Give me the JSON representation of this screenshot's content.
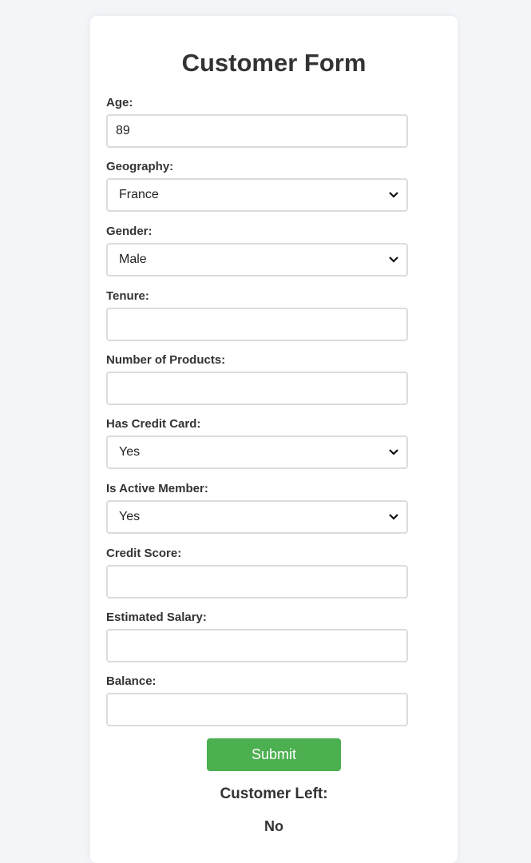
{
  "form": {
    "title": "Customer Form",
    "age": {
      "label": "Age:",
      "value": "89"
    },
    "geography": {
      "label": "Geography:",
      "value": "France"
    },
    "gender": {
      "label": "Gender:",
      "value": "Male"
    },
    "tenure": {
      "label": "Tenure:",
      "value": ""
    },
    "num_products": {
      "label": "Number of Products:",
      "value": ""
    },
    "has_credit_card": {
      "label": "Has Credit Card:",
      "value": "Yes"
    },
    "is_active_member": {
      "label": "Is Active Member:",
      "value": "Yes"
    },
    "credit_score": {
      "label": "Credit Score:",
      "value": ""
    },
    "estimated_salary": {
      "label": "Estimated Salary:",
      "value": ""
    },
    "balance": {
      "label": "Balance:",
      "value": ""
    },
    "submit_label": "Submit"
  },
  "result": {
    "heading": "Customer Left:",
    "value": "No"
  },
  "colors": {
    "submit_button": "#4caf50",
    "page_background": "#f4f5f9"
  },
  "icons": {
    "select_arrow": "chevron-down-icon"
  }
}
